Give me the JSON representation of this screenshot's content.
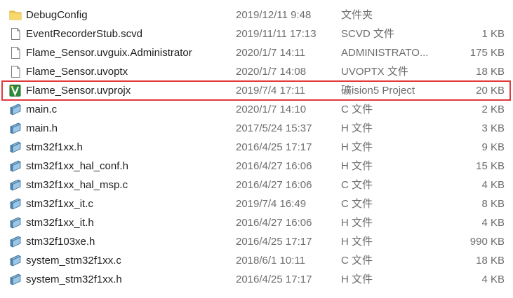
{
  "colors": {
    "selection_outline": "#e0393b",
    "secondary_text": "#6d6d6d",
    "primary_text": "#1e1e1e",
    "folder_yellow": "#f2c94c",
    "uvision_green": "#2e8b3a"
  },
  "files": [
    {
      "name": "DebugConfig",
      "date": "2019/12/11 9:48",
      "type": "文件夹",
      "size": "",
      "icon": "folder-icon"
    },
    {
      "name": "EventRecorderStub.scvd",
      "date": "2019/11/11 17:13",
      "type": "SCVD 文件",
      "size": "1 KB",
      "icon": "blank-file-icon"
    },
    {
      "name": "Flame_Sensor.uvguix.Administrator",
      "date": "2020/1/7 14:11",
      "type": "ADMINISTRATO...",
      "size": "175 KB",
      "icon": "blank-file-icon"
    },
    {
      "name": "Flame_Sensor.uvoptx",
      "date": "2020/1/7 14:08",
      "type": "UVOPTX 文件",
      "size": "18 KB",
      "icon": "blank-file-icon"
    },
    {
      "name": "Flame_Sensor.uvprojx",
      "date": "2019/7/4 17:11",
      "type": "礦ision5 Project",
      "size": "20 KB",
      "icon": "uvision-project-icon"
    },
    {
      "name": "main.c",
      "date": "2020/1/7 14:10",
      "type": "C 文件",
      "size": "2 KB",
      "icon": "source-file-icon"
    },
    {
      "name": "main.h",
      "date": "2017/5/24 15:37",
      "type": "H 文件",
      "size": "3 KB",
      "icon": "source-file-icon"
    },
    {
      "name": "stm32f1xx.h",
      "date": "2016/4/25 17:17",
      "type": "H 文件",
      "size": "9 KB",
      "icon": "source-file-icon"
    },
    {
      "name": "stm32f1xx_hal_conf.h",
      "date": "2016/4/27 16:06",
      "type": "H 文件",
      "size": "15 KB",
      "icon": "source-file-icon"
    },
    {
      "name": "stm32f1xx_hal_msp.c",
      "date": "2016/4/27 16:06",
      "type": "C 文件",
      "size": "4 KB",
      "icon": "source-file-icon"
    },
    {
      "name": "stm32f1xx_it.c",
      "date": "2019/7/4 16:49",
      "type": "C 文件",
      "size": "8 KB",
      "icon": "source-file-icon"
    },
    {
      "name": "stm32f1xx_it.h",
      "date": "2016/4/27 16:06",
      "type": "H 文件",
      "size": "4 KB",
      "icon": "source-file-icon"
    },
    {
      "name": "stm32f103xe.h",
      "date": "2016/4/25 17:17",
      "type": "H 文件",
      "size": "990 KB",
      "icon": "source-file-icon"
    },
    {
      "name": "system_stm32f1xx.c",
      "date": "2018/6/1 10:11",
      "type": "C 文件",
      "size": "18 KB",
      "icon": "source-file-icon"
    },
    {
      "name": "system_stm32f1xx.h",
      "date": "2016/4/25 17:17",
      "type": "H 文件",
      "size": "4 KB",
      "icon": "source-file-icon"
    }
  ],
  "selected_index": 4
}
